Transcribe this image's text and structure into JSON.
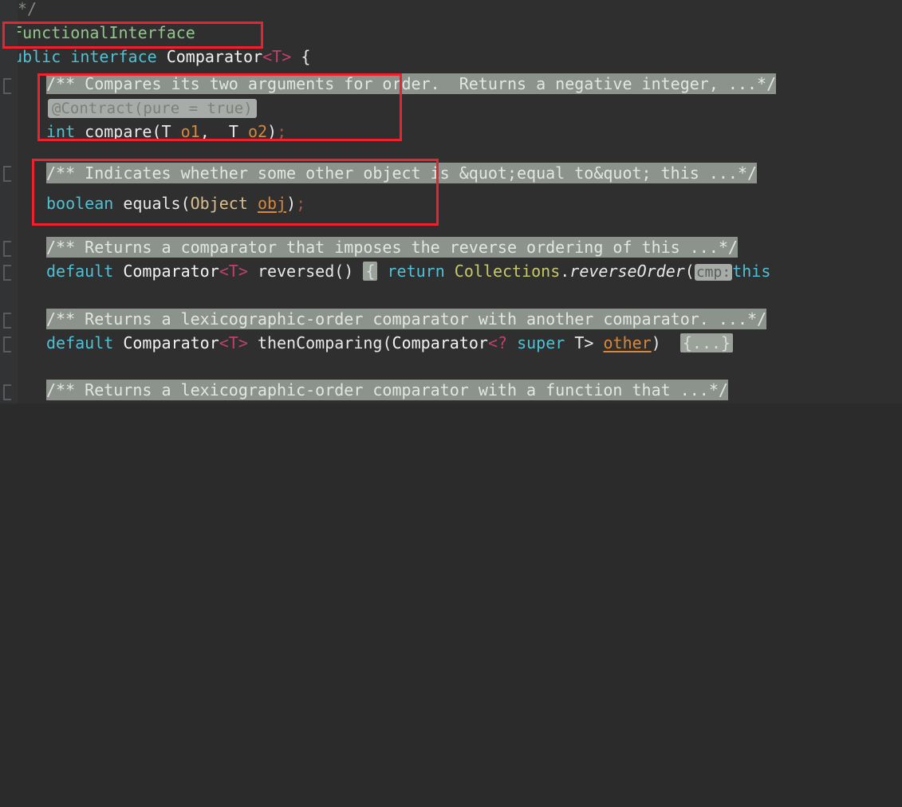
{
  "app": {
    "kind": "code-editor",
    "theme": "darcula",
    "language": "java"
  },
  "colors": {
    "background": "#2f2f2f",
    "gutter": "#313335",
    "keyword": "#4fc1d6",
    "annotation": "#91c78a",
    "parameter": "#d9873b",
    "generic_bracket": "#c0406a",
    "class_reference": "#c8c86a",
    "folded_comment_bg": "#8c938c",
    "inlay_hint_bg": "#a8aca8",
    "highlight_box": "#f0212c",
    "text": "#e8e8e8"
  },
  "code": {
    "lines": [
      {
        "id": "line-doc-close",
        "text": "*/",
        "kind": "comment-close"
      },
      {
        "id": "line-annotation",
        "text": "@FunctionalInterface",
        "at": "@",
        "name": "FunctionalInterface",
        "kind": "annotation"
      },
      {
        "id": "line-interface-decl",
        "kind": "declaration",
        "keyword_public": "public",
        "keyword_interface": "interface",
        "type_name": "Comparator",
        "generic": "<T>",
        "brace": "{"
      },
      {
        "id": "line-compare-doc",
        "kind": "folded-javadoc",
        "text": "/** Compares its two arguments for order.  Returns a negative integer, ...*/"
      },
      {
        "id": "line-contract-hint",
        "kind": "inlay-hint",
        "text": "@Contract(pure = true)"
      },
      {
        "id": "line-compare-decl",
        "kind": "declaration",
        "return_type": "int",
        "method": "compare",
        "open_paren": "(",
        "p1_type": "T",
        "p1_name": "o1",
        "comma": ",",
        "p2_type": "T",
        "p2_name": "o2",
        "close_paren": ")",
        "semicolon": ";"
      },
      {
        "id": "line-equals-doc",
        "kind": "folded-javadoc",
        "text": "/** Indicates whether some other object is &quot;equal to&quot; this ...*/"
      },
      {
        "id": "line-equals-decl",
        "kind": "declaration",
        "return_type": "boolean",
        "method": "equals",
        "open_paren": "(",
        "p1_type": "Object",
        "p1_name": "obj",
        "close_paren": ")",
        "semicolon": ";"
      },
      {
        "id": "line-reversed-doc",
        "kind": "folded-javadoc",
        "text": "/** Returns a comparator that imposes the reverse ordering of this ...*/"
      },
      {
        "id": "line-reversed-decl",
        "kind": "declaration",
        "keyword_default": "default",
        "type_name": "Comparator",
        "generic": "<T>",
        "method": "reversed",
        "parens": "()",
        "brace": "{",
        "keyword_return": "return",
        "class_ref": "Collections",
        "dot": ".",
        "call": "reverseOrder",
        "open_paren": "(",
        "hint": "cmp:",
        "arg": "this"
      },
      {
        "id": "line-thencomparing-doc",
        "kind": "folded-javadoc",
        "text": "/** Returns a lexicographic-order comparator with another comparator. ...*/"
      },
      {
        "id": "line-thencomparing-decl",
        "kind": "declaration",
        "keyword_default": "default",
        "type_name": "Comparator",
        "generic": "<T>",
        "method": "thenComparing",
        "open_paren": "(",
        "arg_type": "Comparator",
        "wildcard": "<?",
        "keyword_super": "super",
        "type_param": "T>",
        "arg_name": "other",
        "close_paren": ")",
        "folded_body": "{...}"
      },
      {
        "id": "line-thencomparing-fn-doc",
        "kind": "folded-javadoc",
        "text": "/** Returns a lexicographic-order comparator with a function that ...*/"
      }
    ]
  },
  "annotations": {
    "boxes": [
      {
        "id": "box-functional-interface",
        "label": "@FunctionalInterface highlight"
      },
      {
        "id": "box-compare-method",
        "label": "compare method highlight"
      },
      {
        "id": "box-equals-method",
        "label": "equals method highlight"
      }
    ]
  }
}
